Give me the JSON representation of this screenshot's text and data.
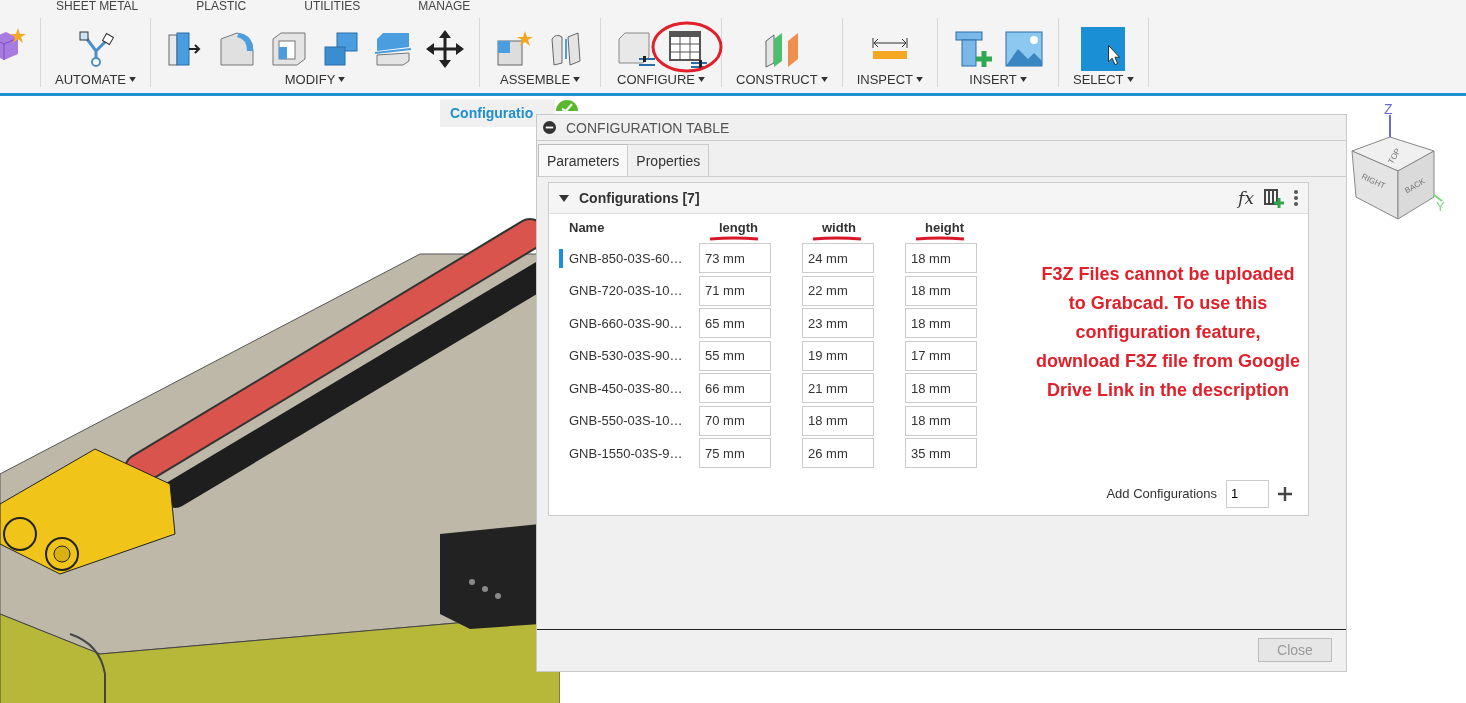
{
  "toolbar_tabs": [
    "SHEET METAL",
    "PLASTIC",
    "UTILITIES",
    "MANAGE"
  ],
  "toolbar_groups": [
    {
      "label": "AUTOMATE",
      "circled": false
    },
    {
      "label": "MODIFY",
      "circled": false
    },
    {
      "label": "ASSEMBLE",
      "circled": false
    },
    {
      "label": "CONFIGURE",
      "circled": true
    },
    {
      "label": "CONSTRUCT",
      "circled": false
    },
    {
      "label": "INSPECT",
      "circled": false
    },
    {
      "label": "INSERT",
      "circled": false
    },
    {
      "label": "SELECT",
      "circled": false
    }
  ],
  "breadcrumb": {
    "label": "Configuratio"
  },
  "dialog": {
    "title": "CONFIGURATION TABLE",
    "tabs": [
      {
        "label": "Parameters",
        "selected": true
      },
      {
        "label": "Properties",
        "selected": false
      }
    ],
    "section": {
      "title": "Configurations [7]",
      "expanded": true,
      "formula_button": "fx"
    },
    "columns": [
      {
        "label": "Name",
        "underlined": false
      },
      {
        "label": "length",
        "underlined": true
      },
      {
        "label": "width",
        "underlined": true
      },
      {
        "label": "height",
        "underlined": true
      }
    ],
    "rows": [
      {
        "name": "GNB-850-03S-60…",
        "selected": true,
        "values": [
          "73 mm",
          "24 mm",
          "18 mm"
        ]
      },
      {
        "name": "GNB-720-03S-10…",
        "selected": false,
        "values": [
          "71 mm",
          "22 mm",
          "18 mm"
        ]
      },
      {
        "name": "GNB-660-03S-90…",
        "selected": false,
        "values": [
          "65 mm",
          "23 mm",
          "18 mm"
        ]
      },
      {
        "name": "GNB-530-03S-90…",
        "selected": false,
        "values": [
          "55 mm",
          "19 mm",
          "17 mm"
        ]
      },
      {
        "name": "GNB-450-03S-80…",
        "selected": false,
        "values": [
          "66 mm",
          "21 mm",
          "18 mm"
        ]
      },
      {
        "name": "GNB-550-03S-10…",
        "selected": false,
        "values": [
          "70 mm",
          "18 mm",
          "18 mm"
        ]
      },
      {
        "name": "GNB-1550-03S-9…",
        "selected": false,
        "values": [
          "75 mm",
          "26 mm",
          "35 mm"
        ]
      }
    ],
    "add_row": {
      "label": "Add Configurations",
      "value": "1"
    },
    "close_button": {
      "label": "Close",
      "disabled": true
    }
  },
  "annotation": {
    "text": "F3Z Files cannot be uploaded\nto Grabcad. To use this\nconfiguration feature,\ndownload F3Z file from Google\nDrive Link in the description"
  },
  "view_cube": {
    "faces": [
      "TOP",
      "RIGHT",
      "BACK"
    ],
    "axes": [
      "Z",
      "Y"
    ]
  }
}
